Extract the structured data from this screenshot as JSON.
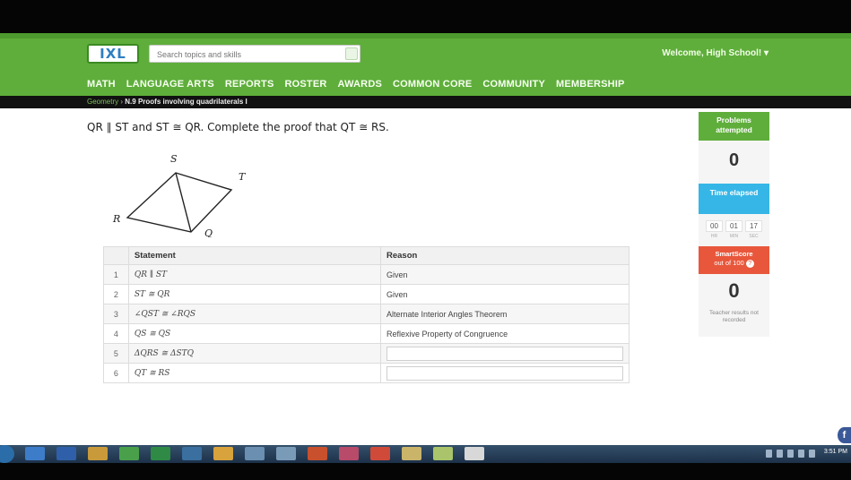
{
  "header": {
    "logo": {
      "main": "IXL",
      "accent": ""
    },
    "search_placeholder": "Search topics and skills",
    "welcome": "Welcome, High School! ▾",
    "nav": [
      "MATH",
      "LANGUAGE ARTS",
      "REPORTS",
      "ROSTER",
      "AWARDS",
      "COMMON CORE",
      "COMMUNITY",
      "MEMBERSHIP"
    ],
    "brand_green": "#5fae3b"
  },
  "breadcrumb": {
    "link": "Geometry",
    "separator": "›",
    "current": "N.9 Proofs involving quadrilaterals I"
  },
  "question": "QR ∥ ST and ST ≅ QR. Complete the proof that QT ≅ RS.",
  "diagram": {
    "labels": {
      "S": "S",
      "T": "T",
      "R": "R",
      "Q": "Q"
    }
  },
  "proof": {
    "headers": {
      "statement": "Statement",
      "reason": "Reason"
    },
    "rows": [
      {
        "num": "1",
        "statement": "QR ∥ ST",
        "reason": "Given",
        "input": false
      },
      {
        "num": "2",
        "statement": "ST ≅ QR",
        "reason": "Given",
        "input": false
      },
      {
        "num": "3",
        "statement": "∠QST ≅ ∠RQS",
        "reason": "Alternate Interior Angles Theorem",
        "input": false
      },
      {
        "num": "4",
        "statement": "QS ≅ QS",
        "reason": "Reflexive Property of Congruence",
        "input": false
      },
      {
        "num": "5",
        "statement": "ΔQRS ≅ ΔSTQ",
        "reason": "",
        "input": true
      },
      {
        "num": "6",
        "statement": "QT ≅ RS",
        "reason": "",
        "input": true
      }
    ]
  },
  "side_panel": {
    "problems_label": "Problems attempted",
    "problems_count": "0",
    "time_label": "Time elapsed",
    "timer": {
      "hr": "00",
      "min": "01",
      "sec": "17",
      "hr_unit": "HR",
      "min_unit": "MIN",
      "sec_unit": "SEC"
    },
    "smartscore_label": "SmartScore",
    "smartscore_sub": "out of 100",
    "help_icon": "?",
    "smartscore": "0",
    "teacher_note": "Teacher results not recorded",
    "colors": {
      "problems": "#5fae3b",
      "time": "#36b6e6",
      "smartscore": "#e8573b"
    }
  },
  "social": {
    "label": "f"
  },
  "taskbar": {
    "clock": "3:51 PM",
    "icons": [
      "ie-icon",
      "word-icon",
      "folder-icon",
      "chrome-icon",
      "excel-icon",
      "media-icon",
      "folder-icon",
      "network-icon",
      "mail-icon",
      "powerpoint-icon",
      "paint-icon",
      "explorer-icon",
      "window-icon",
      "window-icon",
      "window-icon"
    ]
  }
}
